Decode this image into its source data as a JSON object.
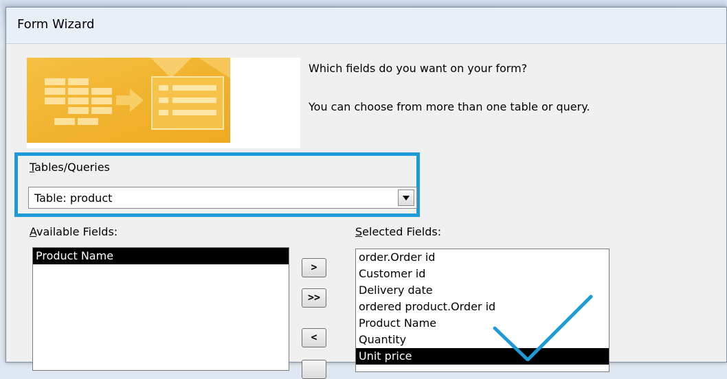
{
  "window": {
    "title": "Form Wizard"
  },
  "intro": {
    "line1": "Which fields do you want on your form?",
    "line2": "You can choose from more than one table or query."
  },
  "tables_queries": {
    "label_first": "T",
    "label_rest": "ables/Queries",
    "selected": "Table: product"
  },
  "available_fields": {
    "label_first": "A",
    "label_rest": "vailable Fields:",
    "items": [
      "Product Name"
    ]
  },
  "selected_fields": {
    "label_first": "S",
    "label_rest": "elected Fields:",
    "items": [
      "order.Order id",
      "Customer id",
      "Delivery date",
      "ordered product.Order id",
      "Product Name",
      "Quantity",
      "Unit price"
    ]
  },
  "buttons": {
    "add_one": ">",
    "add_all": ">>",
    "remove_one": "<"
  },
  "colors": {
    "highlight_frame": "#1d9bd6",
    "checkmark": "#1d9bd6",
    "graphic_orange": "#f3b42a"
  }
}
